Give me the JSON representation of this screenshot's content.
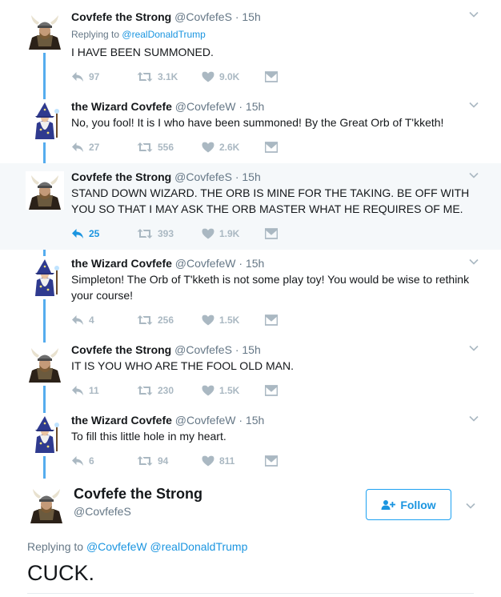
{
  "tweets": [
    {
      "avatar": "viking-avatar",
      "name": "Covfefe the Strong",
      "handle": "@CovfefeS",
      "dot": "·",
      "time": "15h",
      "replying_prefix": "Replying to",
      "replying_to": "@realDonaldTrump",
      "text": "I HAVE BEEN SUMMONED.",
      "replies": "97",
      "retweets": "3.1K",
      "likes": "9.0K"
    },
    {
      "avatar": "wizard-avatar",
      "name": "the Wizard Covfefe",
      "handle": "@CovfefeW",
      "dot": "·",
      "time": "15h",
      "text": "No, you fool! It is I who have been summoned! By the Great Orb of T'kketh!",
      "replies": "27",
      "retweets": "556",
      "likes": "2.6K"
    },
    {
      "avatar": "viking-avatar",
      "name": "Covfefe the Strong",
      "handle": "@CovfefeS",
      "dot": "·",
      "time": "15h",
      "text": "STAND DOWN WIZARD. THE ORB IS MINE FOR THE TAKING. BE OFF WITH YOU SO THAT I MAY ASK THE ORB MASTER WHAT HE REQUIRES OF ME.",
      "replies": "25",
      "retweets": "393",
      "likes": "1.9K"
    },
    {
      "avatar": "wizard-avatar",
      "name": "the Wizard Covfefe",
      "handle": "@CovfefeW",
      "dot": "·",
      "time": "15h",
      "text": "Simpleton! The Orb of T'kketh is not some play toy! You would be wise to rethink your course!",
      "replies": "4",
      "retweets": "256",
      "likes": "1.5K"
    },
    {
      "avatar": "viking-avatar",
      "name": "Covfefe the Strong",
      "handle": "@CovfefeS",
      "dot": "·",
      "time": "15h",
      "text": "IT IS YOU WHO ARE THE FOOL OLD MAN.",
      "replies": "11",
      "retweets": "230",
      "likes": "1.5K"
    },
    {
      "avatar": "wizard-avatar",
      "name": "the Wizard Covfefe",
      "handle": "@CovfefeW",
      "dot": "·",
      "time": "15h",
      "text": "To fill this little hole in my heart.",
      "replies": "6",
      "retweets": "94",
      "likes": "811"
    }
  ],
  "main": {
    "avatar": "viking-avatar",
    "name": "Covfefe the Strong",
    "handle": "@CovfefeS",
    "follow_label": "Follow",
    "replying_prefix": "Replying to",
    "replying_to_1": "@CovfefeW",
    "replying_to_2": "@realDonaldTrump",
    "text": "CUCK."
  },
  "colors": {
    "link": "#1b95e0",
    "muted": "#657786",
    "icon": "#aab8c2",
    "thread_line": "#55acee",
    "highlight_bg": "#f5f8fa"
  }
}
